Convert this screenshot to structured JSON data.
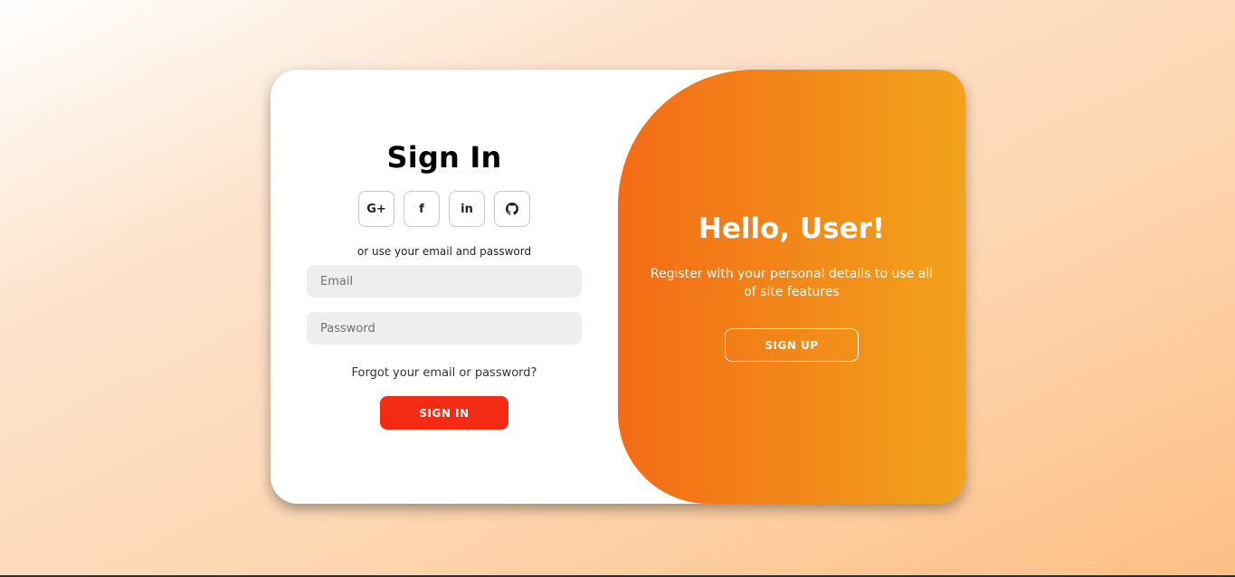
{
  "signin": {
    "title": "Sign In",
    "socials": [
      {
        "icon": "google-plus-icon",
        "glyph": "G+"
      },
      {
        "icon": "facebook-icon",
        "glyph": "f"
      },
      {
        "icon": "linkedin-icon",
        "glyph": "in"
      },
      {
        "icon": "github-icon",
        "glyph": "⊙"
      }
    ],
    "alt_text": "or use your email and password",
    "email_placeholder": "Email",
    "password_placeholder": "Password",
    "forgot_label": "Forgot your email or password?",
    "button_label": "SIGN IN"
  },
  "toggle": {
    "title": "Hello, User!",
    "text": "Register with your personal details to use all of site features",
    "button_label": "SIGN UP"
  },
  "colors": {
    "accent_red": "#f32a14",
    "gradient_start": "#f36b16",
    "gradient_end": "#f2a31c"
  }
}
